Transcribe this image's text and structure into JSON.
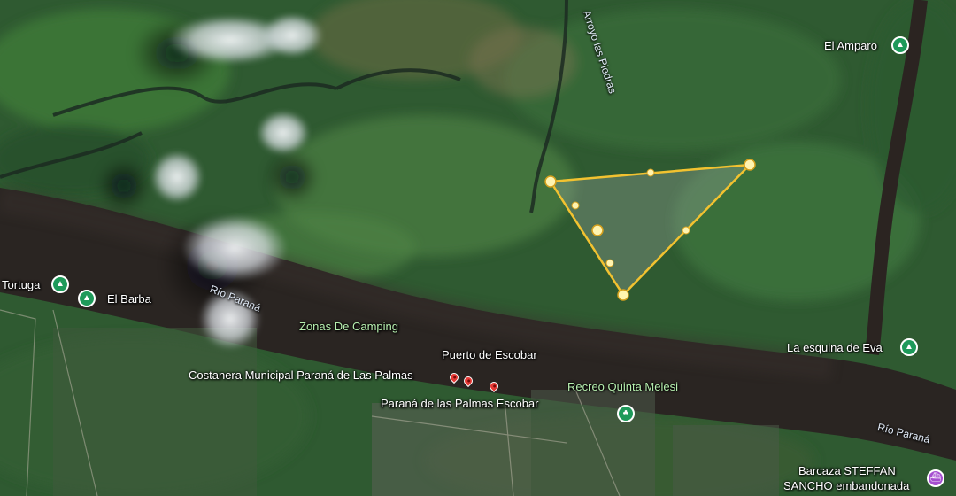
{
  "map": {
    "view": "satellite",
    "polygon": {
      "shape": "triangle",
      "stroke_color": "#f2c230",
      "vertex_color": "#fff4b0"
    },
    "colors": {
      "river": "#2a2522",
      "vegetation": "#2d5a2e",
      "pin_green": "#1e9a5a",
      "pin_purple": "#a64fd0",
      "pin_red": "#e53935"
    }
  },
  "labels": {
    "el_amparo": "El Amparo",
    "arroyo_las_piedras": "Arroyo las Piedras",
    "tortuga": "Tortuga",
    "el_barba": "El Barba",
    "rio_parana_west": "Río Paraná",
    "rio_parana_east": "Río Paraná",
    "zonas_de_camping": "Zonas De Camping",
    "puerto_de_escobar": "Puerto de Escobar",
    "costanera": "Costanera Municipal Paraná de Las Palmas",
    "parana_de_las_palmas_escobar": "Paraná de las Palmas Escobar",
    "recreo_quinta_melesi": "Recreo Quinta Melesi",
    "la_esquina_de_eva": "La esquina de Eva",
    "barcaza_line1": "Barcaza STEFFAN",
    "barcaza_line2": "SANCHO embandonada"
  },
  "icons": {
    "campground": "campground-icon",
    "park": "tree-icon",
    "boat": "boat-icon",
    "marker": "red-marker-icon"
  }
}
